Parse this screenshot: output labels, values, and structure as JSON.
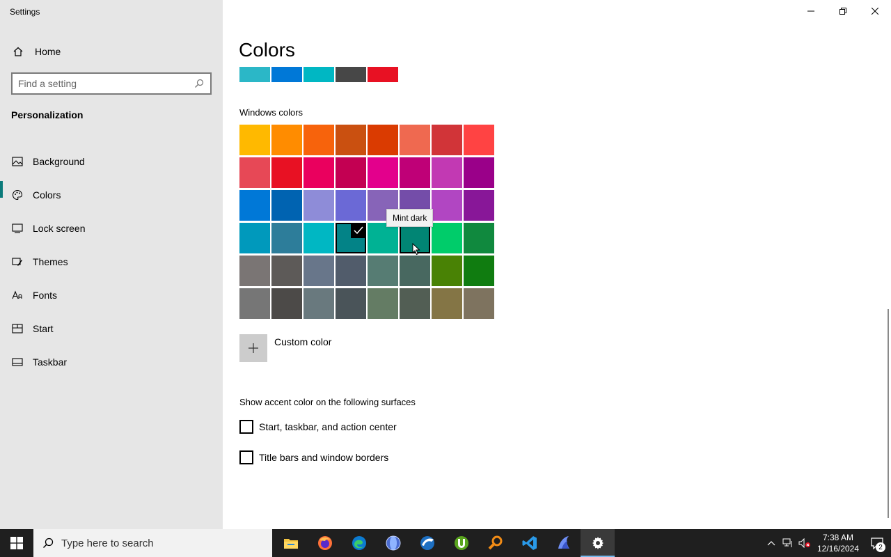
{
  "window": {
    "title": "Settings"
  },
  "sidebar": {
    "home_label": "Home",
    "search_placeholder": "Find a setting",
    "section": "Personalization",
    "items": [
      {
        "label": "Background",
        "icon": "image-icon"
      },
      {
        "label": "Colors",
        "icon": "palette-icon",
        "active": true
      },
      {
        "label": "Lock screen",
        "icon": "lock-screen-icon"
      },
      {
        "label": "Themes",
        "icon": "brush-icon"
      },
      {
        "label": "Fonts",
        "icon": "font-icon"
      },
      {
        "label": "Start",
        "icon": "start-icon"
      },
      {
        "label": "Taskbar",
        "icon": "taskbar-icon"
      }
    ]
  },
  "main": {
    "title": "Colors",
    "recent_colors": [
      "#2bb7c7",
      "#0078d7",
      "#00b7c3",
      "#474747",
      "#e81123"
    ],
    "windows_colors_label": "Windows colors",
    "grid": [
      [
        "#ffb900",
        "#ff8c00",
        "#f7630c",
        "#ca5010",
        "#da3b01",
        "#ef6950",
        "#d13438",
        "#ff4343"
      ],
      [
        "#e74856",
        "#e81123",
        "#ea005e",
        "#c30052",
        "#e3008c",
        "#bf0077",
        "#c239b3",
        "#9a0089"
      ],
      [
        "#0078d7",
        "#0063b1",
        "#8e8cd8",
        "#6b69d6",
        "#8764b8",
        "#744da9",
        "#b146c2",
        "#881798"
      ],
      [
        "#0099bc",
        "#2d7d9a",
        "#00b7c3",
        "#038387",
        "#00b294",
        "#018574",
        "#00cc6a",
        "#10893e"
      ],
      [
        "#7a7574",
        "#5d5a58",
        "#68768a",
        "#515c6b",
        "#567c73",
        "#486860",
        "#498205",
        "#107c10"
      ],
      [
        "#767676",
        "#4c4a48",
        "#69797e",
        "#4a5459",
        "#647c64",
        "#525e54",
        "#847545",
        "#7e735f"
      ]
    ],
    "selected_color": "#038387",
    "tooltip": "Mint dark",
    "custom_color_label": "Custom color",
    "accent_surfaces_label": "Show accent color on the following surfaces",
    "checkboxes": [
      {
        "label": "Start, taskbar, and action center",
        "checked": false
      },
      {
        "label": "Title bars and window borders",
        "checked": false
      }
    ]
  },
  "taskbar": {
    "search_placeholder": "Type here to search",
    "apps": [
      "file-explorer-icon",
      "firefox-icon",
      "edge-icon",
      "globe-app-icon",
      "browser-app-icon",
      "utorrent-icon",
      "search-app-icon",
      "vscode-icon",
      "dolphin-icon",
      "settings-gear-icon"
    ],
    "time": "7:38 AM",
    "date": "12/16/2024",
    "notification_count": "2"
  }
}
